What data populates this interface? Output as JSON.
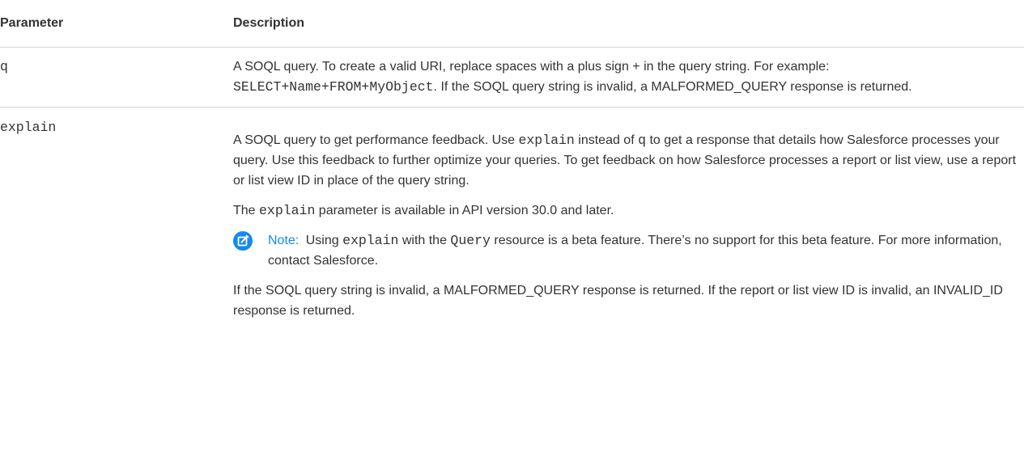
{
  "table": {
    "header": {
      "parameter": "Parameter",
      "description": "Description"
    },
    "rows": {
      "q": {
        "param": "q",
        "desc_1": "A SOQL query. To create a valid URI, replace spaces with a plus sign + in the query string. For example:",
        "desc_code": "SELECT+Name+FROM+MyObject",
        "desc_2": ". If the SOQL query string is invalid, a MALFORMED_QUERY response is returned."
      },
      "explain": {
        "param": "explain",
        "p1_a": "A SOQL query to get performance feedback. Use",
        "p1_code1": "explain",
        "p1_b": "instead of",
        "p1_code2": "q",
        "p1_c": "to get a response that details how Salesforce processes your query. Use this feedback to further optimize your queries. To get feedback on how Salesforce processes a report or list view, use a report or list view ID in place of the query string.",
        "p2_a": "The",
        "p2_code": "explain",
        "p2_b": "parameter is available in API version 30.0 and later.",
        "note_label": "Note:",
        "note_a": "Using",
        "note_code1": "explain",
        "note_b": "with the",
        "note_code2": "Query",
        "note_c": "resource is a beta feature. There’s no support for this beta feature. For more information, contact Salesforce.",
        "p3": "If the SOQL query string is invalid, a MALFORMED_QUERY response is returned. If the report or list view ID is invalid, an INVALID_ID response is returned."
      }
    }
  },
  "colors": {
    "note_accent": "#1589ee",
    "text": "#333333",
    "rule": "#d9d9d9"
  },
  "icons": {
    "note": "edit-note-icon"
  }
}
